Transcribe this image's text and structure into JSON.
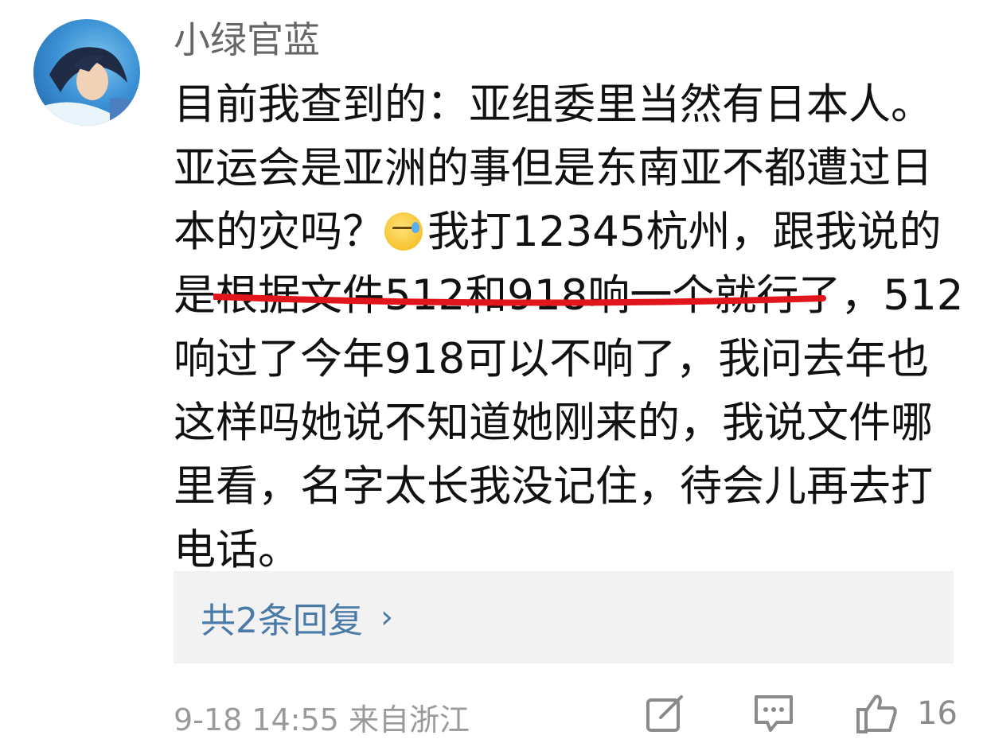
{
  "comment": {
    "username": "小绿官蓝",
    "lines": [
      "目前我查到的：亚组委里当然有日本人。",
      "亚运会是亚洲的事但是东南亚不都遭过日",
      "本的灾吗？",
      "我打12345杭州，跟我说的",
      "是根据文件512和918响一个就行了，512",
      "响过了今年918可以不响了，我问去年也",
      "这样吗她说不知道她刚来的，我说文件哪",
      "里看，名字太长我没记住，待会儿再去打",
      "电话。"
    ],
    "emoji": "sad-sweat-emoji"
  },
  "replies": {
    "label": "共2条回复",
    "chevron": "›"
  },
  "footer": {
    "timestamp": "9-18 14:55",
    "location": "来自浙江",
    "like_count": "16"
  },
  "annotation": {
    "underline_color": "#e0161c"
  }
}
